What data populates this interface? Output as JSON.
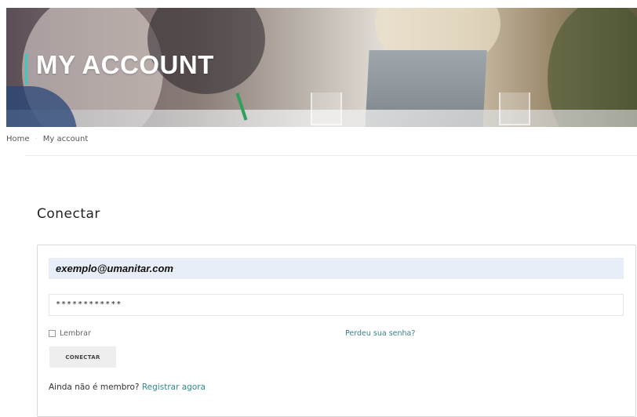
{
  "hero": {
    "title": "MY ACCOUNT"
  },
  "breadcrumb": {
    "items": [
      "Home",
      "My account"
    ]
  },
  "page": {
    "heading": "Conectar"
  },
  "login_form": {
    "email_value": "exemplo@umanitar.com",
    "password_value": "************",
    "remember_label": "Lembrar",
    "forgot_label": "Perdeu sua senha?",
    "submit_label": "CONECTAR",
    "register_prompt": "Ainda não é membro?",
    "register_link": "Registrar agora"
  },
  "colors": {
    "accent": "#3ec8c0",
    "link": "#3a7f8c",
    "autofill_bg": "#e8eef8"
  }
}
